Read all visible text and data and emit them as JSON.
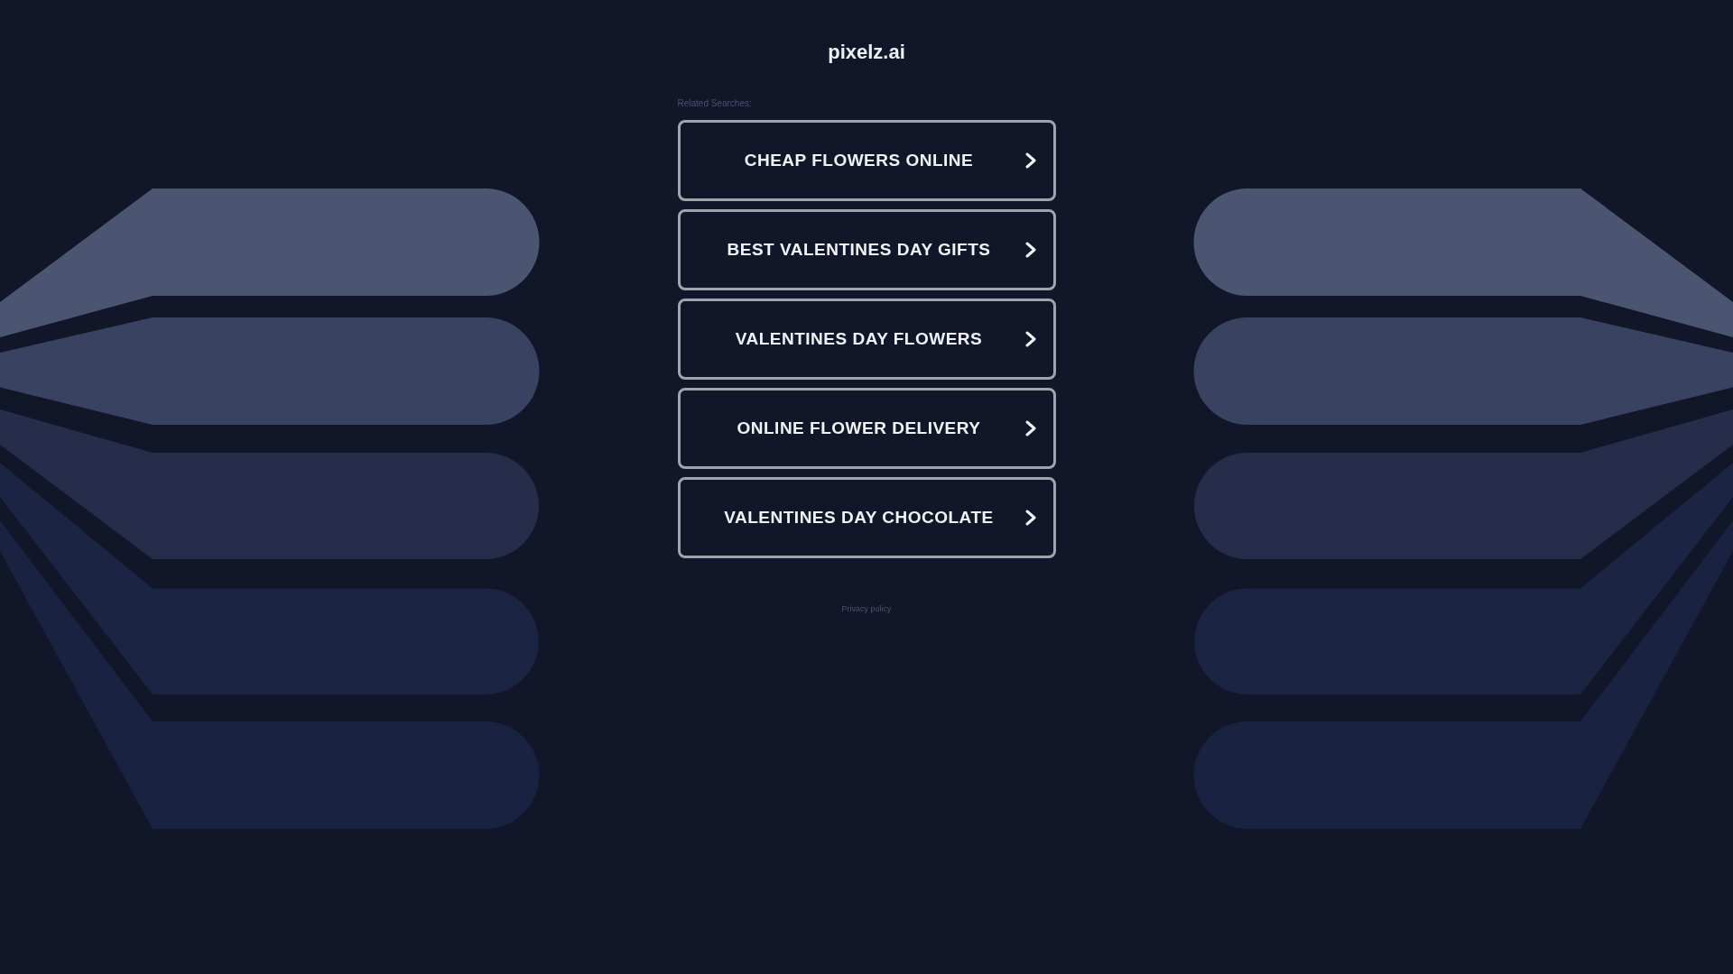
{
  "site_title": "pixelz.ai",
  "related_searches": {
    "label": "Related Searches:",
    "items": [
      {
        "label": "CHEAP FLOWERS ONLINE"
      },
      {
        "label": "BEST VALENTINES DAY GIFTS"
      },
      {
        "label": "VALENTINES DAY FLOWERS"
      },
      {
        "label": "ONLINE FLOWER DELIVERY"
      },
      {
        "label": "VALENTINES DAY CHOCOLATE"
      }
    ]
  },
  "footer": {
    "privacy_link": "Privacy policy"
  }
}
